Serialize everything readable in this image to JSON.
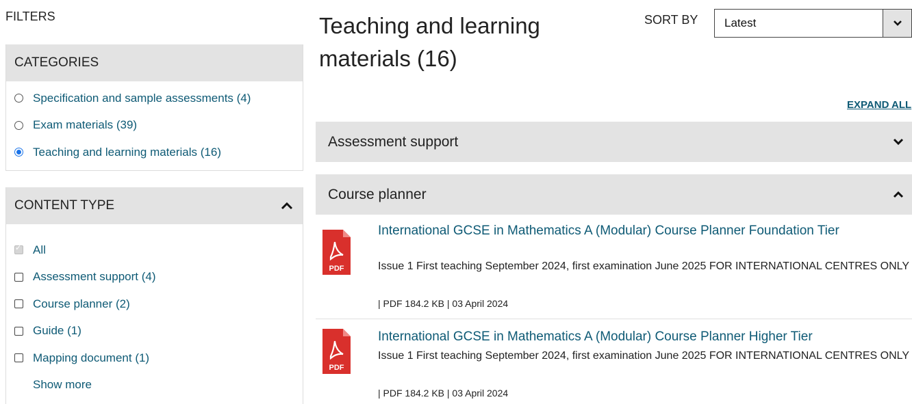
{
  "filters": {
    "title": "FILTERS",
    "categories": {
      "heading": "CATEGORIES",
      "items": [
        {
          "label": "Specification and sample assessments (4)",
          "selected": false
        },
        {
          "label": "Exam materials (39)",
          "selected": false
        },
        {
          "label": "Teaching and learning materials (16)",
          "selected": true
        }
      ]
    },
    "content_type": {
      "heading": "CONTENT TYPE",
      "items": [
        {
          "label": "All",
          "checked": true,
          "disabled": true
        },
        {
          "label": "Assessment support (4)",
          "checked": false
        },
        {
          "label": "Course planner (2)",
          "checked": false
        },
        {
          "label": "Guide (1)",
          "checked": false
        },
        {
          "label": "Mapping document (1)",
          "checked": false
        }
      ],
      "show_more": "Show more"
    }
  },
  "main": {
    "title": "Teaching and learning materials (16)",
    "sort": {
      "label": "SORT BY",
      "value": "Latest"
    },
    "expand_all": "EXPAND ALL",
    "sections": [
      {
        "label": "Assessment support",
        "expanded": false
      },
      {
        "label": "Course planner",
        "expanded": true
      }
    ],
    "documents": [
      {
        "title": "International GCSE in Mathematics A (Modular) Course Planner Foundation Tier",
        "description": "Issue 1 First teaching September 2024, first examination June 2025 FOR INTERNATIONAL CENTRES ONLY",
        "meta": "| PDF 184.2 KB | 03 April 2024",
        "icon": "pdf-icon",
        "icon_label": "PDF"
      },
      {
        "title": "International GCSE in Mathematics A (Modular) Course Planner Higher Tier",
        "description": "Issue 1 First teaching September 2024, first examination June 2025 FOR INTERNATIONAL CENTRES ONLY",
        "meta": "| PDF 184.2 KB | 03 April 2024",
        "icon": "pdf-icon",
        "icon_label": "PDF"
      }
    ]
  },
  "colors": {
    "link": "#0e5a75",
    "panel_header": "#e3e3e3",
    "pdf_red": "#d9302c",
    "radio_selected": "#1a73e8"
  }
}
